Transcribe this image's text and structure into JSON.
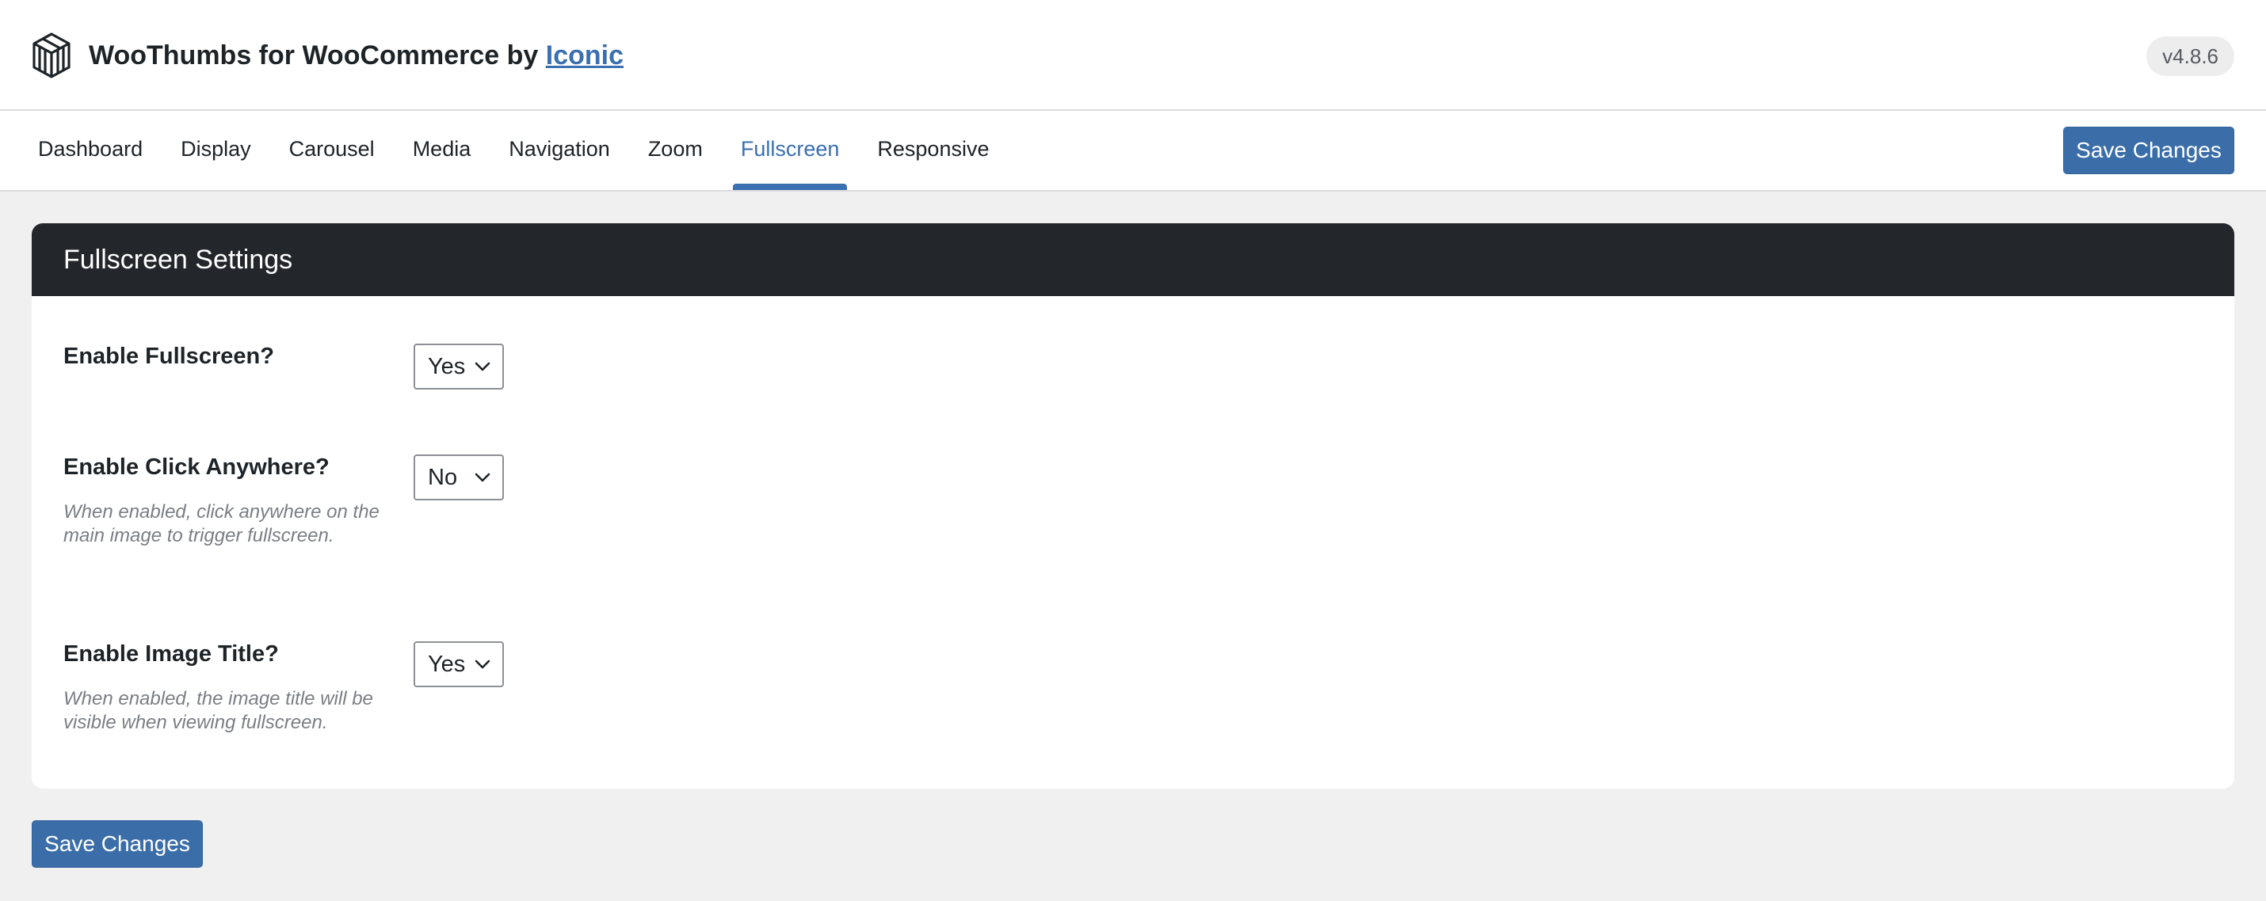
{
  "header": {
    "title_prefix": "WooThumbs for WooCommerce by ",
    "title_link": "Iconic",
    "version": "v4.8.6",
    "logo_icon": "iconic-cube-logo-icon"
  },
  "tabs": [
    {
      "label": "Dashboard",
      "active": false
    },
    {
      "label": "Display",
      "active": false
    },
    {
      "label": "Carousel",
      "active": false
    },
    {
      "label": "Media",
      "active": false
    },
    {
      "label": "Navigation",
      "active": false
    },
    {
      "label": "Zoom",
      "active": false
    },
    {
      "label": "Fullscreen",
      "active": true
    },
    {
      "label": "Responsive",
      "active": false
    }
  ],
  "toolbar": {
    "save_label": "Save Changes"
  },
  "section": {
    "title": "Fullscreen Settings",
    "settings": [
      {
        "label": "Enable Fullscreen?",
        "value": "Yes",
        "description": ""
      },
      {
        "label": "Enable Click Anywhere?",
        "value": "No",
        "description": "When enabled, click anywhere on the main image to trigger fullscreen."
      },
      {
        "label": "Enable Image Title?",
        "value": "Yes",
        "description": "When enabled, the image title will be visible when viewing fullscreen."
      }
    ]
  },
  "footer": {
    "save_label": "Save Changes"
  },
  "colors": {
    "accent": "#3a6fb0",
    "button": "#3b6ea9",
    "section_header": "#23262b",
    "page_bg": "#f0f0f1"
  }
}
